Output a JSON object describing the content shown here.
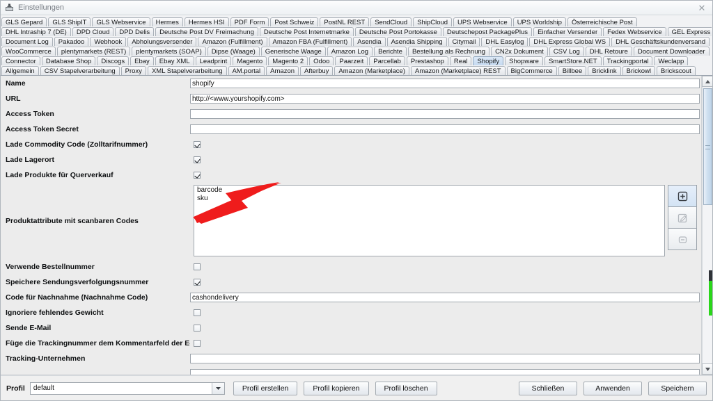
{
  "window": {
    "title": "Einstellungen",
    "icon": "app-icon",
    "close_label": "✕"
  },
  "tabs": {
    "selected": "Shopify",
    "rows": [
      [
        "GLS Gepard",
        "GLS ShipIT",
        "GLS Webservice",
        "Hermes",
        "Hermes HSI",
        "PDF Form",
        "Post Schweiz",
        "PostNL REST",
        "SendCloud",
        "ShipCloud",
        "UPS Webservice",
        "UPS Worldship",
        "Österreichische Post"
      ],
      [
        "DHL Intraship 7 (DE)",
        "DPD Cloud",
        "DPD Delis",
        "Deutsche Post DV Freimachung",
        "Deutsche Post Internetmarke",
        "Deutsche Post Portokasse",
        "Deutschepost PackagePlus",
        "Einfacher Versender",
        "Fedex Webservice",
        "GEL Express"
      ],
      [
        "Document Log",
        "Pakadoo",
        "Webhook",
        "Abholungsversender",
        "Amazon (Fulfillment)",
        "Amazon FBA (Fulfillment)",
        "Asendia",
        "Asendia Shipping",
        "Citymail",
        "DHL Easylog",
        "DHL Express Global WS",
        "DHL Geschäftskundenversand"
      ],
      [
        "WooCommerce",
        "plentymarkets (REST)",
        "plentymarkets (SOAP)",
        "Dipse (Waage)",
        "Generische Waage",
        "Amazon Log",
        "Berichte",
        "Bestellung als Rechnung",
        "CN2x Dokument",
        "CSV Log",
        "DHL Retoure",
        "Document Downloader"
      ],
      [
        "Connector",
        "Database Shop",
        "Discogs",
        "Ebay",
        "Ebay XML",
        "Leadprint",
        "Magento",
        "Magento 2",
        "Odoo",
        "Paarzeit",
        "Parcellab",
        "Prestashop",
        "Real",
        "Shopify",
        "Shopware",
        "SmartStore.NET",
        "Trackingportal",
        "Weclapp"
      ],
      [
        "Allgemein",
        "CSV Stapelverarbeitung",
        "Proxy",
        "XML Stapelverarbeitung",
        "AM.portal",
        "Amazon",
        "Afterbuy",
        "Amazon (Marketplace)",
        "Amazon (Marketplace) REST",
        "BigCommerce",
        "Billbee",
        "Bricklink",
        "Brickowl",
        "Brickscout"
      ]
    ]
  },
  "form": {
    "fields": [
      {
        "label": "Name",
        "type": "text",
        "value": "shopify"
      },
      {
        "label": "URL",
        "type": "text",
        "value": "http://<www.yourshopify.com>"
      },
      {
        "label": "Access Token",
        "type": "text",
        "value": ""
      },
      {
        "label": "Access Token Secret",
        "type": "text",
        "value": ""
      },
      {
        "label": "Lade Commodity Code (Zolltarifnummer)",
        "type": "checkbox",
        "checked": true
      },
      {
        "label": "Lade Lagerort",
        "type": "checkbox",
        "checked": true
      },
      {
        "label": "Lade Produkte für Querverkauf",
        "type": "checkbox",
        "checked": true
      }
    ],
    "list_field": {
      "label": "Produktattribute mit scanbaren Codes",
      "items": [
        "barcode",
        "sku"
      ],
      "buttons": [
        {
          "name": "add-icon",
          "glyph": "+"
        },
        {
          "name": "edit-icon",
          "glyph": "✎"
        },
        {
          "name": "remove-icon",
          "glyph": "−"
        }
      ]
    },
    "fields2": [
      {
        "label": "Verwende Bestellnummer",
        "type": "checkbox",
        "checked": false
      },
      {
        "label": "Speichere Sendungsverfolgungsnummer",
        "type": "checkbox",
        "checked": true
      },
      {
        "label": "Code für Nachnahme (Nachnahme Code)",
        "type": "text",
        "value": "cashondelivery"
      },
      {
        "label": "Ignoriere fehlendes Gewicht",
        "type": "checkbox",
        "checked": false
      },
      {
        "label": "Sende E-Mail",
        "type": "checkbox",
        "checked": false
      },
      {
        "label": "Füge die Trackingnummer dem Kommentarfeld der E-Mail hinzu",
        "type": "checkbox",
        "checked": false
      },
      {
        "label": "Tracking-Unternehmen",
        "type": "text",
        "value": ""
      },
      {
        "label": "",
        "type": "text",
        "value": ""
      }
    ]
  },
  "bottom": {
    "profile_label": "Profil",
    "profile_value": "default",
    "buttons_left": [
      "Profil erstellen",
      "Profil kopieren",
      "Profil löschen"
    ],
    "buttons_right": [
      "Schließen",
      "Anwenden",
      "Speichern"
    ]
  },
  "annotation": {
    "type": "arrow",
    "color": "#ef1c1c",
    "points_at": "Lade Commodity Code (Zolltarifnummer) checkbox"
  }
}
